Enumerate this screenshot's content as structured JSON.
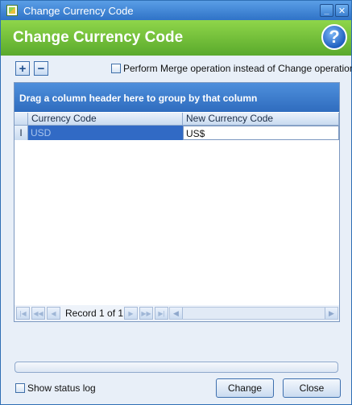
{
  "window": {
    "title": "Change Currency Code",
    "minimize_label": "_",
    "close_label": "✕"
  },
  "header": {
    "title": "Change Currency Code",
    "help_label": "?"
  },
  "toolbar": {
    "add_label": "+",
    "remove_label": "−",
    "merge_label": "Perform Merge operation instead of Change operation.",
    "merge_checked": false
  },
  "grid": {
    "group_panel_text": "Drag a column header here to group by that column",
    "columns": [
      "Currency Code",
      "New Currency Code"
    ],
    "rows": [
      {
        "indicator": "I",
        "currency_code": "USD",
        "new_currency_code": "US$"
      }
    ]
  },
  "navigator": {
    "record_text": "Record 1 of 1",
    "first": "|◀",
    "prev_page": "◀◀",
    "prev": "◀",
    "next": "▶",
    "next_page": "▶▶",
    "last": "▶|",
    "scroll_left": "◀",
    "scroll_right": "▶"
  },
  "progress": {
    "value_percent": 0
  },
  "footer": {
    "status_log_label": "Show status log",
    "status_log_checked": false,
    "change_label": "Change",
    "close_label": "Close"
  },
  "colors": {
    "title_bar": "#2f73c7",
    "header_green": "#6ab838",
    "selected_cell": "#316ac5"
  }
}
